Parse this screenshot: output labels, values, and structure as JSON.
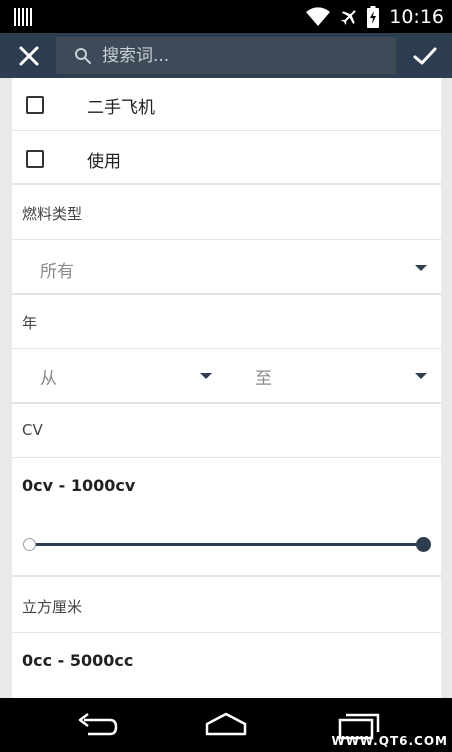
{
  "statusbar": {
    "time": "10:16",
    "icons": [
      "barcode-icon",
      "wifi-icon",
      "airplane-mode-icon",
      "battery-icon"
    ]
  },
  "toolbar": {
    "close_icon": "close-icon",
    "confirm_icon": "check-icon",
    "search_icon": "search-icon",
    "search_placeholder": "搜索词..."
  },
  "filters": {
    "checkbox_items": [
      {
        "label": "二手飞机",
        "checked": false
      },
      {
        "label": "使用",
        "checked": false
      }
    ],
    "fuel_type": {
      "title": "燃料类型",
      "selected": "所有"
    },
    "year": {
      "title": "年",
      "from_placeholder": "从",
      "to_placeholder": "至"
    },
    "cv": {
      "title": "CV",
      "range_text": "0cv - 1000cv",
      "min": 0,
      "max": 1000,
      "selected_min": 0,
      "selected_max": 1000
    },
    "cc": {
      "title": "立方厘米",
      "range_text": "0cc - 5000cc",
      "min": 0,
      "max": 5000
    }
  },
  "navbar": {
    "back_icon": "back-icon",
    "home_icon": "home-icon",
    "recents_icon": "recents-icon"
  },
  "watermark": "WWW.QT6.COM",
  "colors": {
    "accent": "#2c3e50",
    "search_bg": "#3d4b59"
  }
}
